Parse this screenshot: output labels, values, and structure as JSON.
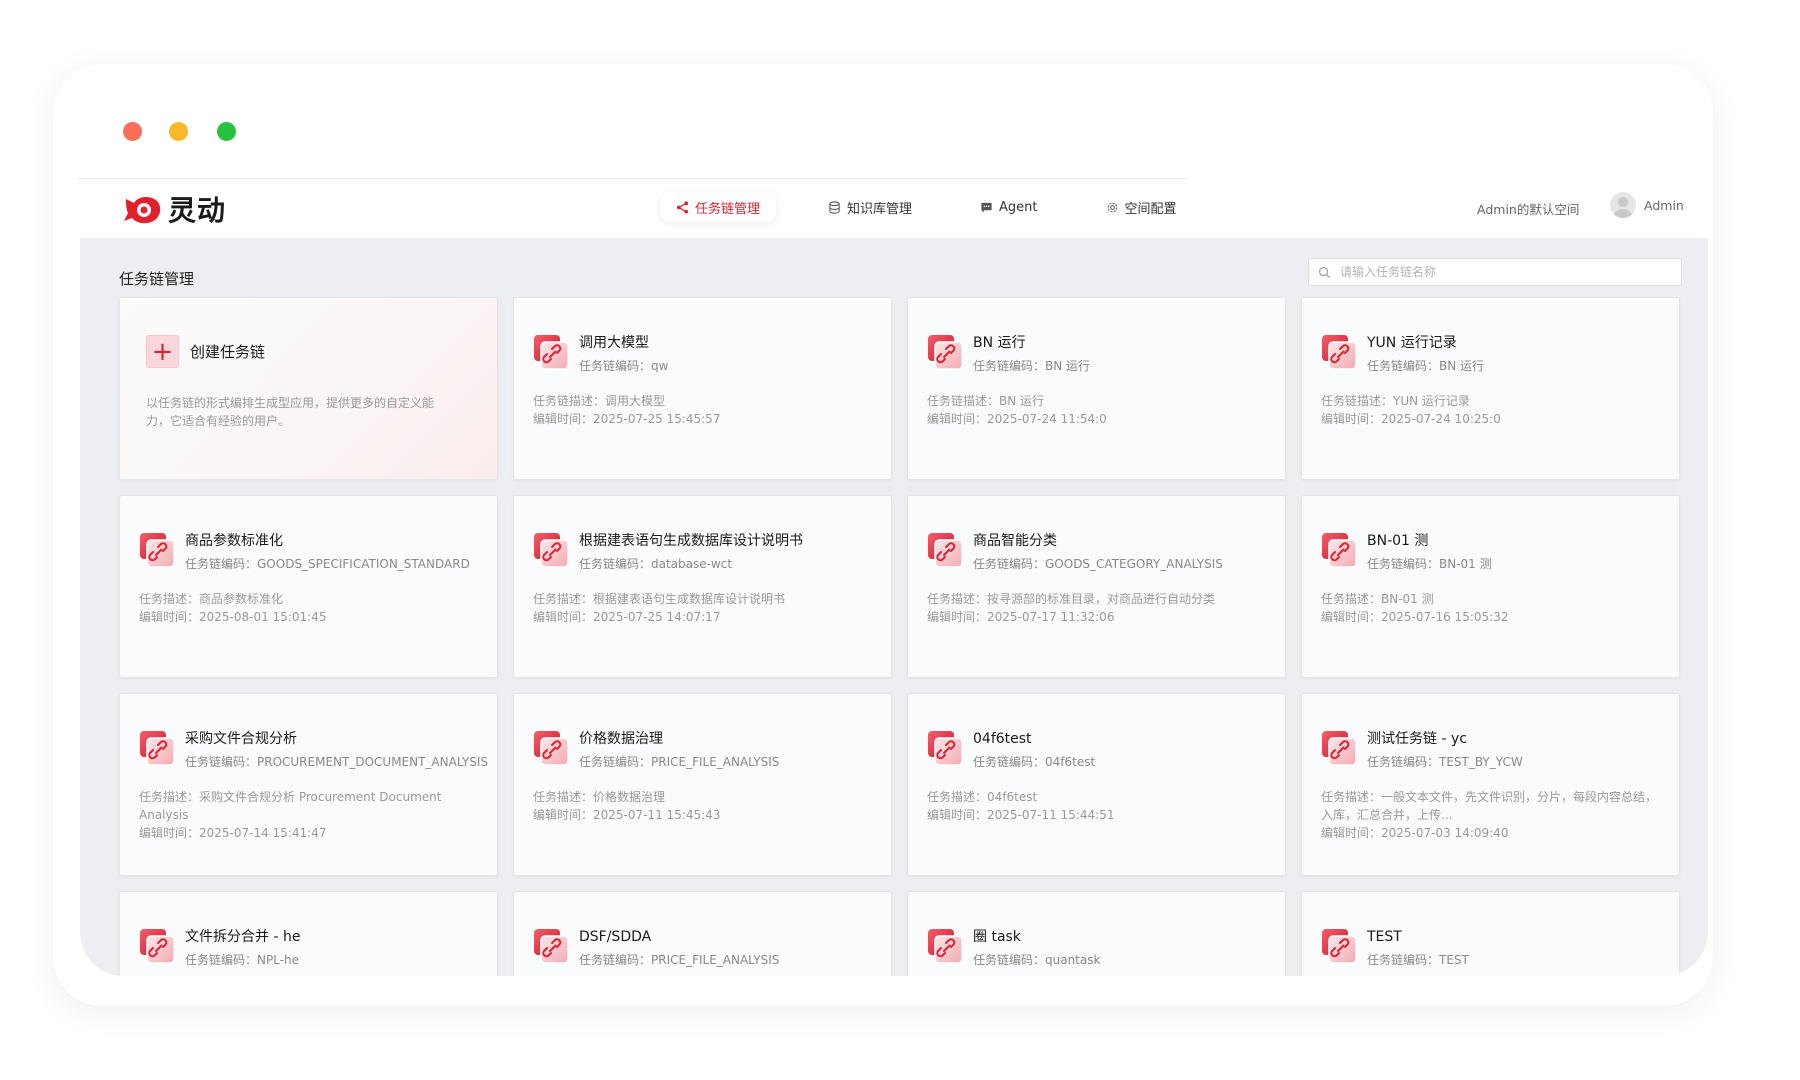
{
  "logo": {
    "text": "灵动"
  },
  "nav": [
    {
      "label": "任务链管理",
      "icon": "share-icon"
    },
    {
      "label": "知识库管理",
      "icon": "database-icon"
    },
    {
      "label": "Agent",
      "icon": "chat-icon"
    },
    {
      "label": "空间配置",
      "icon": "gear-icon"
    }
  ],
  "header": {
    "workspace": "Admin的默认空间",
    "user": "Admin"
  },
  "page": {
    "title": "任务链管理",
    "search_placeholder": "请输入任务链名称"
  },
  "create_card": {
    "title": "创建任务链",
    "desc": "以任务链的形式编排生成型应用，提供更多的自定义能力，它适合有经验的用户。"
  },
  "cards": [
    {
      "title": "调用大模型",
      "code": "任务链编码：qw",
      "desc": "任务链描述：调用大模型",
      "time": "编辑时间：2025-07-25 15:45:57"
    },
    {
      "title": "BN 运行",
      "code": "任务链编码：BN 运行",
      "desc": "任务链描述：BN 运行",
      "time": "编辑时间：2025-07-24 11:54:0"
    },
    {
      "title": "YUN 运行记录",
      "code": "任务链编码：BN 运行",
      "desc": "任务链描述：YUN 运行记录",
      "time": "编辑时间：2025-07-24 10:25:0"
    },
    {
      "title": "商品参数标准化",
      "code": "任务链编码：GOODS_SPECIFICATION_STANDARD",
      "desc": "任务描述：商品参数标准化",
      "time": "编辑时间：2025-08-01 15:01:45"
    },
    {
      "title": "根据建表语句生成数据库设计说明书",
      "code": "任务链编码：database-wct",
      "desc": "任务描述：根据建表语句生成数据库设计说明书",
      "time": "编辑时间：2025-07-25 14:07:17"
    },
    {
      "title": "商品智能分类",
      "code": "任务链编码：GOODS_CATEGORY_ANALYSIS",
      "desc": "任务描述：按寻源部的标准目录，对商品进行自动分类",
      "time": "编辑时间：2025-07-17 11:32:06"
    },
    {
      "title": "BN-01 测",
      "code": "任务链编码：BN-01 测",
      "desc": "任务描述：BN-01 测",
      "time": "编辑时间：2025-07-16 15:05:32"
    },
    {
      "title": "采购文件合规分析",
      "code": "任务链编码：PROCUREMENT_DOCUMENT_ANALYSIS",
      "desc": "任务描述：采购文件合规分析 Procurement Document Analysis",
      "time": "编辑时间：2025-07-14 15:41:47"
    },
    {
      "title": "价格数据治理",
      "code": "任务链编码：PRICE_FILE_ANALYSIS",
      "desc": "任务描述：价格数据治理",
      "time": "编辑时间：2025-07-11 15:45:43"
    },
    {
      "title": "04f6test",
      "code": "任务链编码：04f6test",
      "desc": "任务描述：04f6test",
      "time": "编辑时间：2025-07-11 15:44:51"
    },
    {
      "title": "测试任务链 - yc",
      "code": "任务链编码：TEST_BY_YCW",
      "desc": "任务描述：一般文本文件，先文件识别，分片，每段内容总结，入库，汇总合并，上传...",
      "time": "编辑时间：2025-07-03 14:09:40"
    },
    {
      "title": "文件拆分合并 - he",
      "code": "任务链编码：NPL-he",
      "desc": "",
      "time": ""
    },
    {
      "title": "DSF/SDDA",
      "code": "任务链编码：PRICE_FILE_ANALYSIS",
      "desc": "",
      "time": ""
    },
    {
      "title": "圈 task",
      "code": "任务链编码：quantask",
      "desc": "",
      "time": ""
    },
    {
      "title": "TEST",
      "code": "任务链编码：TEST",
      "desc": "",
      "time": ""
    }
  ]
}
